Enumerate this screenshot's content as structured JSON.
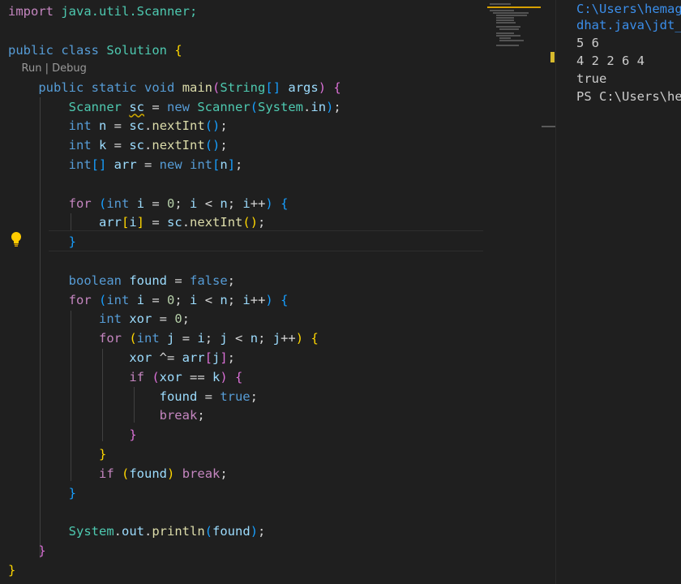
{
  "editor": {
    "codelens": {
      "run": "Run",
      "separator": " | ",
      "debug": "Debug"
    },
    "code": {
      "l1_kw": "import",
      "l1_rest": " java.util.Scanner;",
      "l3_kw1": "public",
      "l3_kw2": "class",
      "l3_name": "Solution",
      "l3_brace": "{",
      "l4_kw1": "public",
      "l4_kw2": "static",
      "l4_kw3": "void",
      "l4_fn": "main",
      "l4_paren_open": "(",
      "l4_type": "String",
      "l4_arr": "[]",
      "l4_param": "args",
      "l4_paren_close": ")",
      "l4_brace": "{",
      "l5_type": "Scanner",
      "l5_var": "sc",
      "l5_eq": " = ",
      "l5_new": "new",
      "l5_type2": "Scanner",
      "l5_po": "(",
      "l5_sys": "System",
      "l5_dot": ".",
      "l5_in": "in",
      "l5_pc": ")",
      "l5_semi": ";",
      "l6_kw": "int",
      "l6_var": "n",
      "l6_eq": " = ",
      "l6_sc": "sc",
      "l6_dot": ".",
      "l6_fn": "nextInt",
      "l6_parens": "()",
      "l6_semi": ";",
      "l7_kw": "int",
      "l7_var": "k",
      "l7_eq": " = ",
      "l7_sc": "sc",
      "l7_dot": ".",
      "l7_fn": "nextInt",
      "l7_parens": "()",
      "l7_semi": ";",
      "l8_kw": "int",
      "l8_br": "[]",
      "l8_var": "arr",
      "l8_eq": " = ",
      "l8_new": "new",
      "l8_kw2": "int",
      "l8_bo": "[",
      "l8_n": "n",
      "l8_bc": "]",
      "l8_semi": ";",
      "l10_for": "for",
      "l10_po": "(",
      "l10_int": "int",
      "l10_i": "i",
      "l10_eq": " = ",
      "l10_zero": "0",
      "l10_semi1": "; ",
      "l10_i2": "i",
      "l10_lt": " < ",
      "l10_n": "n",
      "l10_semi2": "; ",
      "l10_i3": "i",
      "l10_pp": "++",
      "l10_pc": ")",
      "l10_brace": "{",
      "l11_arr": "arr",
      "l11_bo": "[",
      "l11_i": "i",
      "l11_bc": "]",
      "l11_eq": " = ",
      "l11_sc": "sc",
      "l11_dot": ".",
      "l11_fn": "nextInt",
      "l11_parens": "()",
      "l11_semi": ";",
      "l12_brace": "}",
      "l14_kw": "boolean",
      "l14_var": "found",
      "l14_eq": " = ",
      "l14_false": "false",
      "l14_semi": ";",
      "l15_for": "for",
      "l15_po": "(",
      "l15_int": "int",
      "l15_i": "i",
      "l15_eq": " = ",
      "l15_zero": "0",
      "l15_semi1": "; ",
      "l15_i2": "i",
      "l15_lt": " < ",
      "l15_n": "n",
      "l15_semi2": "; ",
      "l15_i3": "i",
      "l15_pp": "++",
      "l15_pc": ")",
      "l15_brace": "{",
      "l16_kw": "int",
      "l16_var": "xor",
      "l16_eq": " = ",
      "l16_zero": "0",
      "l16_semi": ";",
      "l17_for": "for",
      "l17_po": "(",
      "l17_int": "int",
      "l17_j": "j",
      "l17_eq": " = ",
      "l17_i": "i",
      "l17_semi1": "; ",
      "l17_j2": "j",
      "l17_lt": " < ",
      "l17_n": "n",
      "l17_semi2": "; ",
      "l17_j3": "j",
      "l17_pp": "++",
      "l17_pc": ")",
      "l17_brace": "{",
      "l18_xor": "xor",
      "l18_op": " ^= ",
      "l18_arr": "arr",
      "l18_bo": "[",
      "l18_j": "j",
      "l18_bc": "]",
      "l18_semi": ";",
      "l19_if": "if",
      "l19_po": "(",
      "l19_xor": "xor",
      "l19_op": " == ",
      "l19_k": "k",
      "l19_pc": ")",
      "l19_brace": "{",
      "l20_found": "found",
      "l20_eq": " = ",
      "l20_true": "true",
      "l20_semi": ";",
      "l21_break": "break",
      "l21_semi": ";",
      "l22_brace": "}",
      "l23_brace": "}",
      "l24_if": "if",
      "l24_po": "(",
      "l24_found": "found",
      "l24_pc": ")",
      "l24_break": "break",
      "l24_semi": ";",
      "l25_brace": "}",
      "l27_sys": "System",
      "l27_dot1": ".",
      "l27_out": "out",
      "l27_dot2": ".",
      "l27_fn": "println",
      "l27_po": "(",
      "l27_found": "found",
      "l27_pc": ")",
      "l27_semi": ";",
      "l28_brace": "}",
      "l29_brace": "}"
    }
  },
  "terminal": {
    "lines": [
      "C:\\Users\\hemag",
      "dhat.java\\jdt_w",
      "5 6",
      "4 2 2 6 4",
      "true",
      "PS C:\\Users\\hem"
    ]
  },
  "colors": {
    "background": "#1f1f1f",
    "keyword": "#569cd6",
    "control": "#c586c0",
    "type": "#4ec9b0",
    "function": "#dcdcaa",
    "variable": "#9cdcfe",
    "number": "#b5cea8",
    "bracket_level1": "#ffd700",
    "bracket_level2": "#da70d6",
    "bracket_level3": "#179fff",
    "terminal_path": "#3b8eea",
    "terminal_text": "#cccccc"
  }
}
